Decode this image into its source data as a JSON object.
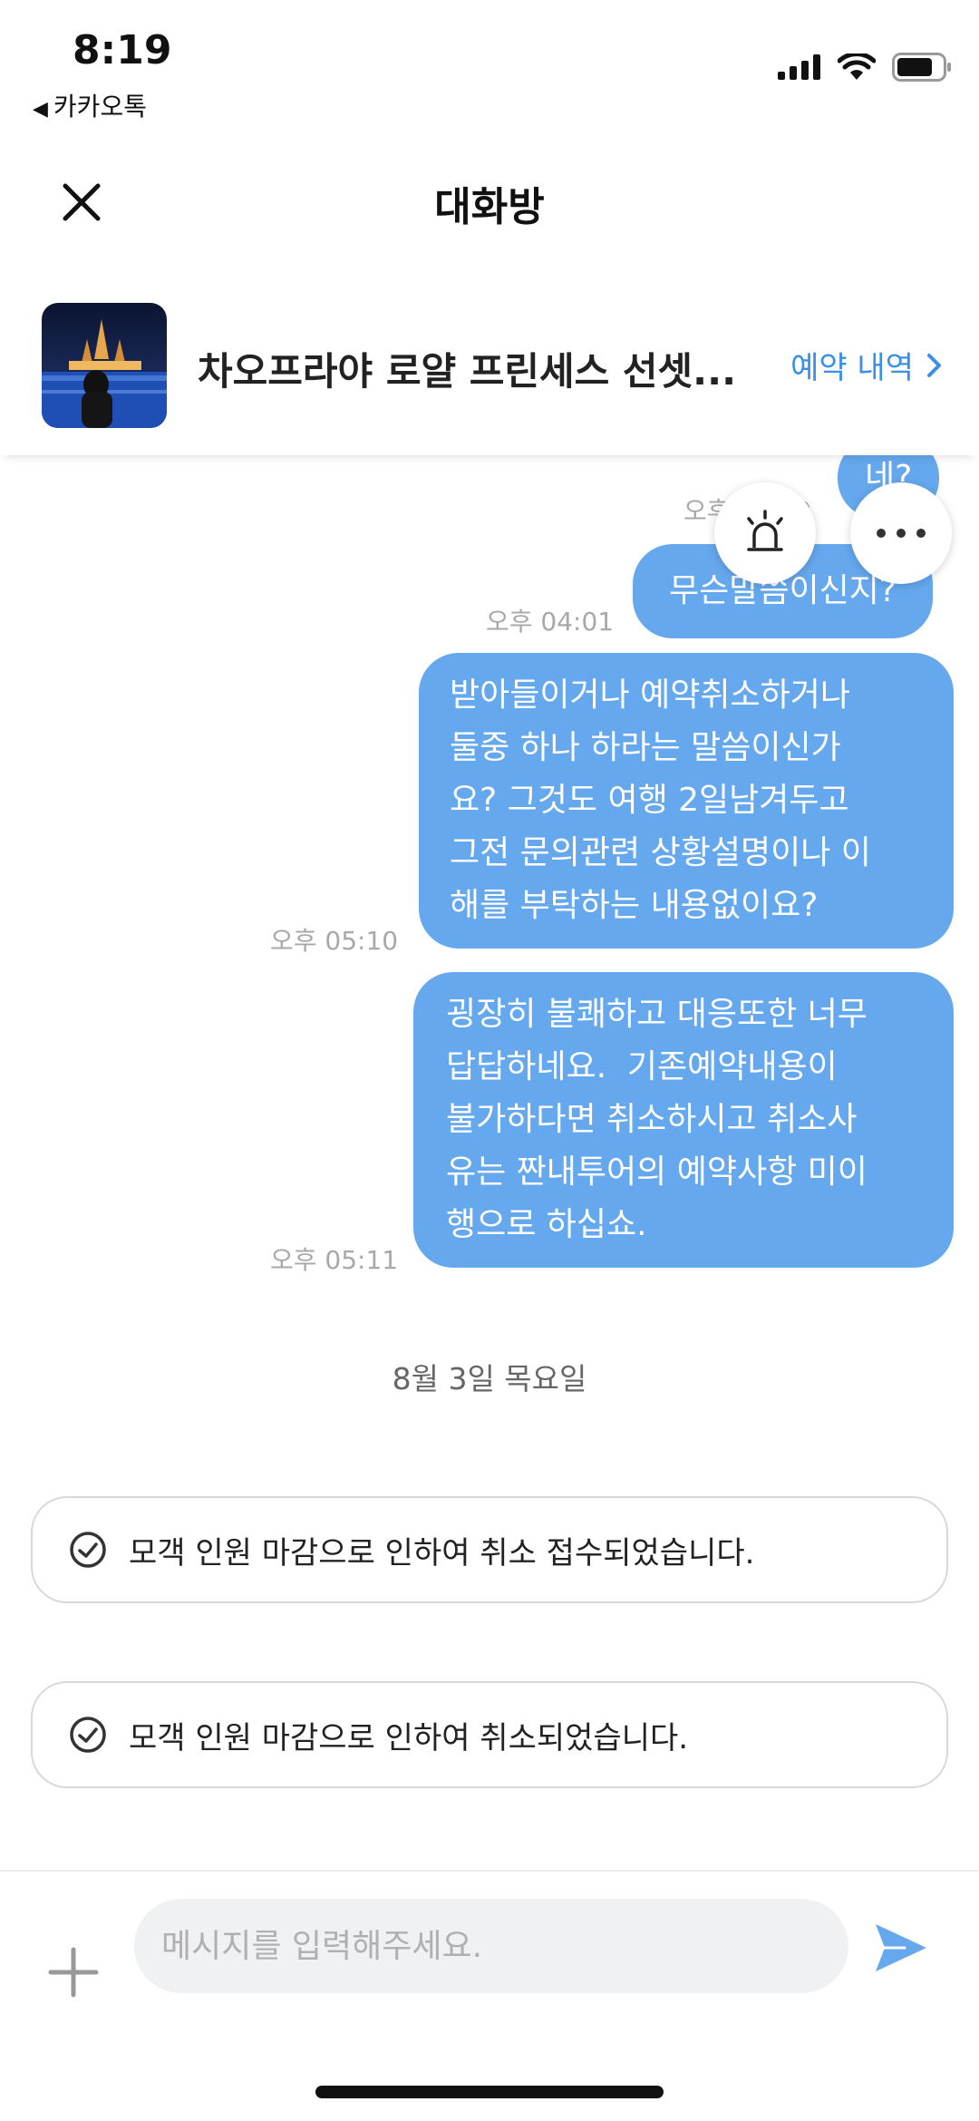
{
  "status_bar": {
    "time": "8:19",
    "back_app": "카카오톡",
    "signal_icon": "cellular-signal-icon",
    "wifi_icon": "wifi-icon",
    "battery_icon": "battery-icon"
  },
  "header": {
    "title": "대화방",
    "close_icon": "close-icon"
  },
  "product": {
    "title": "차오프라야 로얄 프린세스 선셋...",
    "booking_link": "예약 내역",
    "chevron_icon": "chevron-right-icon"
  },
  "chat": {
    "messages": [
      {
        "text": "네?",
        "time": "오후 04:00"
      },
      {
        "text": "무슨말씀이신지?",
        "time": "오후 04:01"
      },
      {
        "lines": [
          "받아들이거나 예약취소하거나",
          "둘중 하나 하라는 말씀이신가",
          "요? 그것도 여행 2일남겨두고",
          "그전 문의관련 상황설명이나 이",
          "해를 부탁하는 내용없이요?"
        ],
        "time": "오후 05:10"
      },
      {
        "lines": [
          "굉장히 불쾌하고 대응또한 너무",
          "답답하네요.  기존예약내용이",
          "불가하다면 취소하시고 취소사",
          "유는 짠내투어의 예약사항 미이",
          "행으로 하십쇼."
        ],
        "time": "오후 05:11"
      }
    ],
    "date_separator": "8월 3일 목요일",
    "system_messages": [
      "모객 인원 마감으로 인하여 취소 접수되었습니다.",
      "모객 인원 마감으로 인하여 취소되었습니다."
    ],
    "alarm_icon": "alarm-siren-icon",
    "more_icon": "more-options-icon"
  },
  "input": {
    "placeholder": "메시지를 입력해주세요.",
    "value": "",
    "plus_icon": "plus-icon",
    "send_icon": "send-icon"
  },
  "colors": {
    "bubble": "#65a8ee",
    "accent": "#3a8fe6",
    "timestamp": "#a8a8a8"
  }
}
